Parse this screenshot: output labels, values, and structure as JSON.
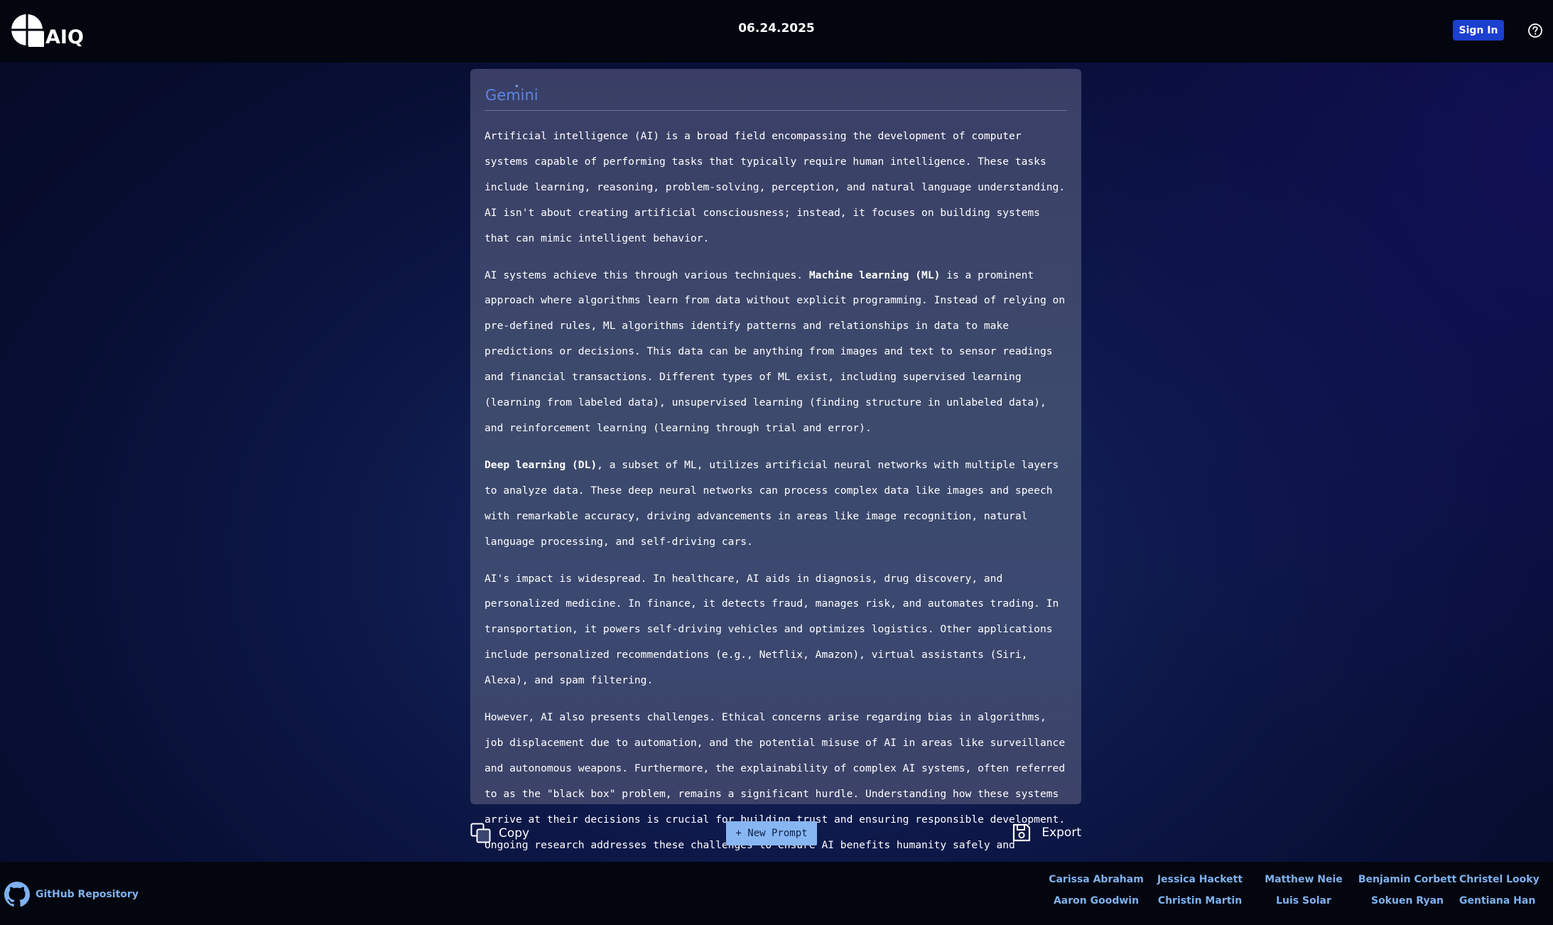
{
  "header": {
    "logo_text": "AIQ",
    "date": "06.24.2025",
    "sign_in_label": "Sign In",
    "help_icon": "help-circle-icon"
  },
  "response": {
    "model_name": "Gemini",
    "paragraphs": [
      {
        "pre": "",
        "bold": "",
        "post": "Artificial intelligence (AI) is a broad field encompassing the development of computer systems capable of performing tasks that typically require human intelligence. These tasks include learning, reasoning, problem-solving, perception, and natural language understanding. AI isn't about creating artificial consciousness; instead, it focuses on building systems that can mimic intelligent behavior."
      },
      {
        "pre": "AI systems achieve this through various techniques. ",
        "bold": "Machine learning (ML)",
        "post": " is a prominent approach where algorithms learn from data without explicit programming. Instead of relying on pre-defined rules, ML algorithms identify patterns and relationships in data to make predictions or decisions. This data can be anything from images and text to sensor readings and financial transactions. Different types of ML exist, including supervised learning (learning from labeled data), unsupervised learning (finding structure in unlabeled data), and reinforcement learning (learning through trial and error)."
      },
      {
        "pre": "",
        "bold": "Deep learning (DL)",
        "post": ", a subset of ML, utilizes artificial neural networks with multiple layers to analyze data. These deep neural networks can process complex data like images and speech with remarkable accuracy, driving advancements in areas like image recognition, natural language processing, and self-driving cars."
      },
      {
        "pre": "",
        "bold": "",
        "post": "AI's impact is widespread. In healthcare, AI aids in diagnosis, drug discovery, and personalized medicine. In finance, it detects fraud, manages risk, and automates trading. In transportation, it powers self-driving vehicles and optimizes logistics. Other applications include personalized recommendations (e.g., Netflix, Amazon), virtual assistants (Siri, Alexa), and spam filtering."
      },
      {
        "pre": "",
        "bold": "",
        "post": "However, AI also presents challenges. Ethical concerns arise regarding bias in algorithms, job displacement due to automation, and the potential misuse of AI in areas like surveillance and autonomous weapons. Furthermore, the explainability of complex AI systems, often referred to as the \"black box\" problem, remains a significant hurdle. Understanding how these systems arrive at their decisions is crucial for building trust and ensuring responsible development. Ongoing research addresses these challenges to ensure AI benefits humanity safely and equitably."
      }
    ]
  },
  "actions": {
    "copy_label": "Copy",
    "new_prompt_label": "+ New Prompt",
    "export_label": "Export"
  },
  "footer": {
    "github_label": "GitHub Repository",
    "contributors": [
      "Carissa Abraham",
      "Jessica Hackett",
      "Matthew Neie",
      "Benjamin Corbett",
      "Christel Looky",
      "Aaron Goodwin",
      "Christin Martin",
      "Luis Solar",
      "Sokuen Ryan",
      "Gentiana Han"
    ]
  },
  "colors": {
    "accent": "#1b3fcf",
    "link": "#7fb1ee",
    "new_prompt_bg": "#87b6f3",
    "header_bg": "#03060f",
    "model_name": "#5a86e6"
  }
}
